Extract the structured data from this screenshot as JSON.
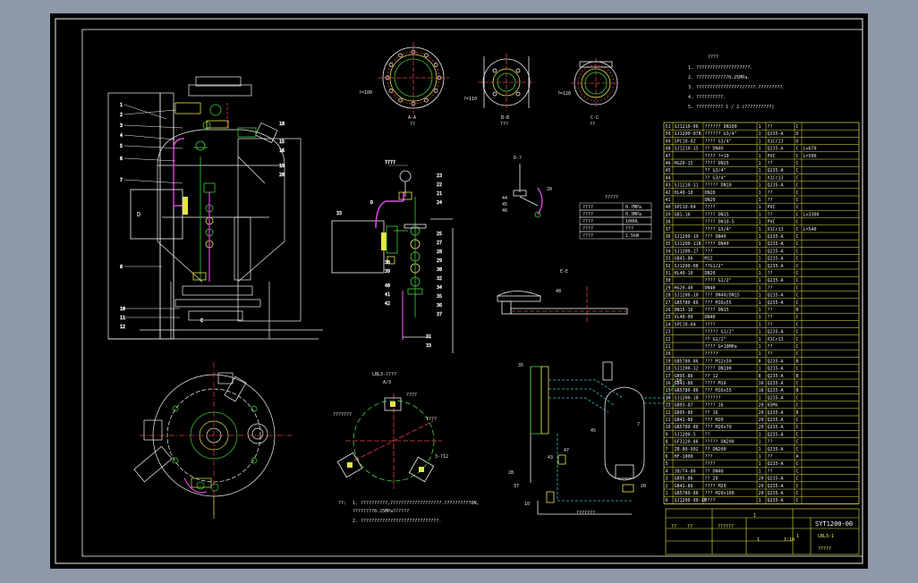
{
  "title_block": {
    "drawing_no": "SYT1200-00",
    "scale": "1:10",
    "sheet": "LBL3-1",
    "qty_1": "1",
    "qty_2": "1",
    "qty_3": "1",
    "note": "?????",
    "hdr_1": "??",
    "hdr_2": "??",
    "hdr_3": "??????"
  },
  "notes": {
    "heading": "????",
    "lines": [
      "1. ????????????????????.",
      "2. ????????????0.25MPa.",
      "3. ?????????????????/????.?????????.",
      "4. ??????????.",
      "5. ?????????? 1 / 2 (??????????)"
    ]
  },
  "spec_table": {
    "heading": "?????",
    "rows": [
      [
        "????",
        "0.7MPa"
      ],
      [
        "????",
        "0.3MPa"
      ],
      [
        "????",
        "1000L"
      ],
      [
        "????",
        "???"
      ],
      [
        "????",
        "1.5kW"
      ]
    ]
  },
  "bom_rows": [
    [
      "51",
      "SJ1210-06",
      "?????? DN100",
      "1",
      "??",
      "C"
    ],
    [
      "50",
      "SJ1200-07B",
      "?????? G3/4\"",
      "1",
      "Q235-A",
      "D"
    ],
    [
      "49",
      "SPC10-02",
      "???? G3/4\"",
      "1",
      "X1Cr13",
      "D"
    ],
    [
      "48",
      "SJ1210-15",
      "?? DN40",
      "1",
      "Q235-A",
      "C",
      "L=670"
    ],
    [
      "47",
      "",
      "????  ?=10",
      "1",
      "PVC",
      "C",
      "L=500"
    ],
    [
      "46",
      "HG20-15",
      "???? DN25",
      "1",
      "??",
      "C"
    ],
    [
      "45",
      "",
      "??  G3/4\"",
      "1",
      "Q235-A",
      "C"
    ],
    [
      "44",
      "",
      "?? G3/4\"",
      "1",
      "X1Cr13",
      "C"
    ],
    [
      "43",
      "SJ1210-11",
      "????? DN10",
      "1",
      "Q235-A",
      "C"
    ],
    [
      "42",
      "HL40-10",
      "DN20",
      "1",
      "??",
      "C"
    ],
    [
      "41",
      "",
      "DN20",
      "1",
      "??",
      "C"
    ],
    [
      "40",
      "SPC10-04",
      "????",
      "1",
      "PVC",
      "C"
    ],
    [
      "39",
      "GB1-16",
      "???? DN15",
      "1",
      "??",
      "C",
      "L=3300"
    ],
    [
      "38",
      "",
      "????  DN10-5",
      "1",
      "PVC",
      "C"
    ],
    [
      "37",
      "",
      "???? G3/4\"",
      "1",
      "X1Cr13",
      "C",
      "L=540"
    ],
    [
      "36",
      "SJ1200-19",
      "??? DN40",
      "1",
      "Q235-A",
      "C"
    ],
    [
      "35",
      "SJ1200-11B",
      "???? DN40",
      "1",
      "Q235-A",
      "C"
    ],
    [
      "34",
      "SJ1200-17",
      "???",
      "1",
      "Q235-A",
      "C"
    ],
    [
      "33",
      "GB41-86",
      "M12",
      "1",
      "Q235-A",
      "C"
    ],
    [
      "32",
      "SJ1200-08",
      "??G1/2\"",
      "1",
      "Q235-A",
      "C"
    ],
    [
      "31",
      "HL40-10",
      "DN20",
      "1",
      "??",
      "C"
    ],
    [
      "30",
      "",
      "????  G1/2\"",
      "1",
      "Q235-A",
      "C"
    ],
    [
      "29",
      "HG20-40",
      "DN40",
      "1",
      "??",
      "C"
    ],
    [
      "28",
      "SJ1200-10",
      "??? DN40/DN15",
      "1",
      "Q235-A",
      "C"
    ],
    [
      "27",
      "GB5780-86",
      "??? M16x55",
      "1",
      "Q235-A",
      "C"
    ],
    [
      "26",
      "DN15-16",
      "???? DN15",
      "1",
      "??",
      "B"
    ],
    [
      "25",
      "VL40-00",
      "DN40",
      "1",
      "??",
      "C"
    ],
    [
      "24",
      "SPC10-04",
      "????",
      "1",
      "??",
      "C"
    ],
    [
      "23",
      "",
      "?????  G1/2\"",
      "1",
      "Q235-A",
      "C"
    ],
    [
      "22",
      "",
      "??  G1/2\"",
      "1",
      "X1Cr13",
      "C"
    ],
    [
      "21",
      "",
      "???? G=10MPa",
      "1",
      "??",
      "C"
    ],
    [
      "20",
      "",
      "?????",
      "1",
      "??",
      "C"
    ],
    [
      "19",
      "GB5780-86",
      "??? M12x50",
      "8",
      "Q235-A",
      "B"
    ],
    [
      "18",
      "SJ1200-12",
      "????  DN100",
      "1",
      "Q235-A",
      "C"
    ],
    [
      "17",
      "GB95-86",
      "?? 12",
      "8",
      "Q235-A",
      "B"
    ],
    [
      "16",
      "GB41-86",
      "???? M16",
      "16",
      "Q235-A",
      "C"
    ],
    [
      "15",
      "GB5780-86",
      "??? M16x55",
      "16",
      "Q235-A",
      "B"
    ],
    [
      "14",
      "SJ1200-18",
      "??????",
      "1",
      "Q235-A",
      "C"
    ],
    [
      "13",
      "GB93-87",
      "????  16",
      "20",
      "65Mn",
      "C"
    ],
    [
      "12",
      "GB95-86",
      "?? 16",
      "20",
      "Q235-A",
      "B"
    ],
    [
      "11",
      "GB41-86",
      "??? M20",
      "20",
      "Q235-A",
      "C"
    ],
    [
      "10",
      "GB5780-86",
      "??? M20x70",
      "20",
      "Q235-A",
      "C"
    ],
    [
      "9",
      "SJ1200-5",
      "??",
      "1",
      "Q235-A",
      "C"
    ],
    [
      "8",
      "GF3120-86",
      "????? DN200",
      "1",
      "??",
      "C"
    ],
    [
      "7",
      "ZB-80-902",
      "?? DN200",
      "1",
      "Q235-A",
      "C"
    ],
    [
      "6",
      "HF-1000",
      "???",
      "1",
      "??",
      "A"
    ],
    [
      "5",
      "",
      "????",
      "1",
      "Q235-A",
      "C"
    ],
    [
      "4",
      "JB/T4-86",
      "?? DN40",
      "1",
      "??",
      "C"
    ],
    [
      "3",
      "GB95-86",
      "?? 20",
      "20",
      "Q235-A",
      "C"
    ],
    [
      "2",
      "GB41-86",
      "???? M20",
      "20",
      "Q235-A",
      "C"
    ],
    [
      "1",
      "GB5780-86",
      "??? M20x100",
      "20",
      "Q235-A",
      "C"
    ],
    [
      "0",
      "SJ1200-00-1B",
      "????",
      "1",
      "Q235-A",
      "C"
    ]
  ],
  "views": {
    "flange_a": "A-A",
    "flange_b": "B-B",
    "flange_c": "C-C",
    "scale_a": "??",
    "scale_b": "???",
    "detail_top": "????",
    "detail_d": "D-?",
    "section_ee": "E-E",
    "plan_title": "LBL3-????",
    "plan_sub": "A/3",
    "plan_label_1": "????",
    "plan_label_2": "???????",
    "plan_label_3": "????",
    "plan_label_4": "3-?12",
    "schematic_caption": "???????",
    "footnote_1": "1. ??????????,???????????????????.??????????DN,",
    "footnote_2": "   ????????0.25MPa??????",
    "footnote_3": "2. ?????????????????????????????.",
    "footnote_mark": "??:",
    "dim_1": "?=100",
    "dim_2": "?=110",
    "dim_3": "?=120"
  },
  "colors": {
    "line": "#f2f2f2",
    "yellow": "#e6e64a",
    "green": "#3fcf3f",
    "magenta": "#d94ad9",
    "cyan": "#3fbfcf",
    "red": "#e04040",
    "blue": "#5a7de0"
  }
}
